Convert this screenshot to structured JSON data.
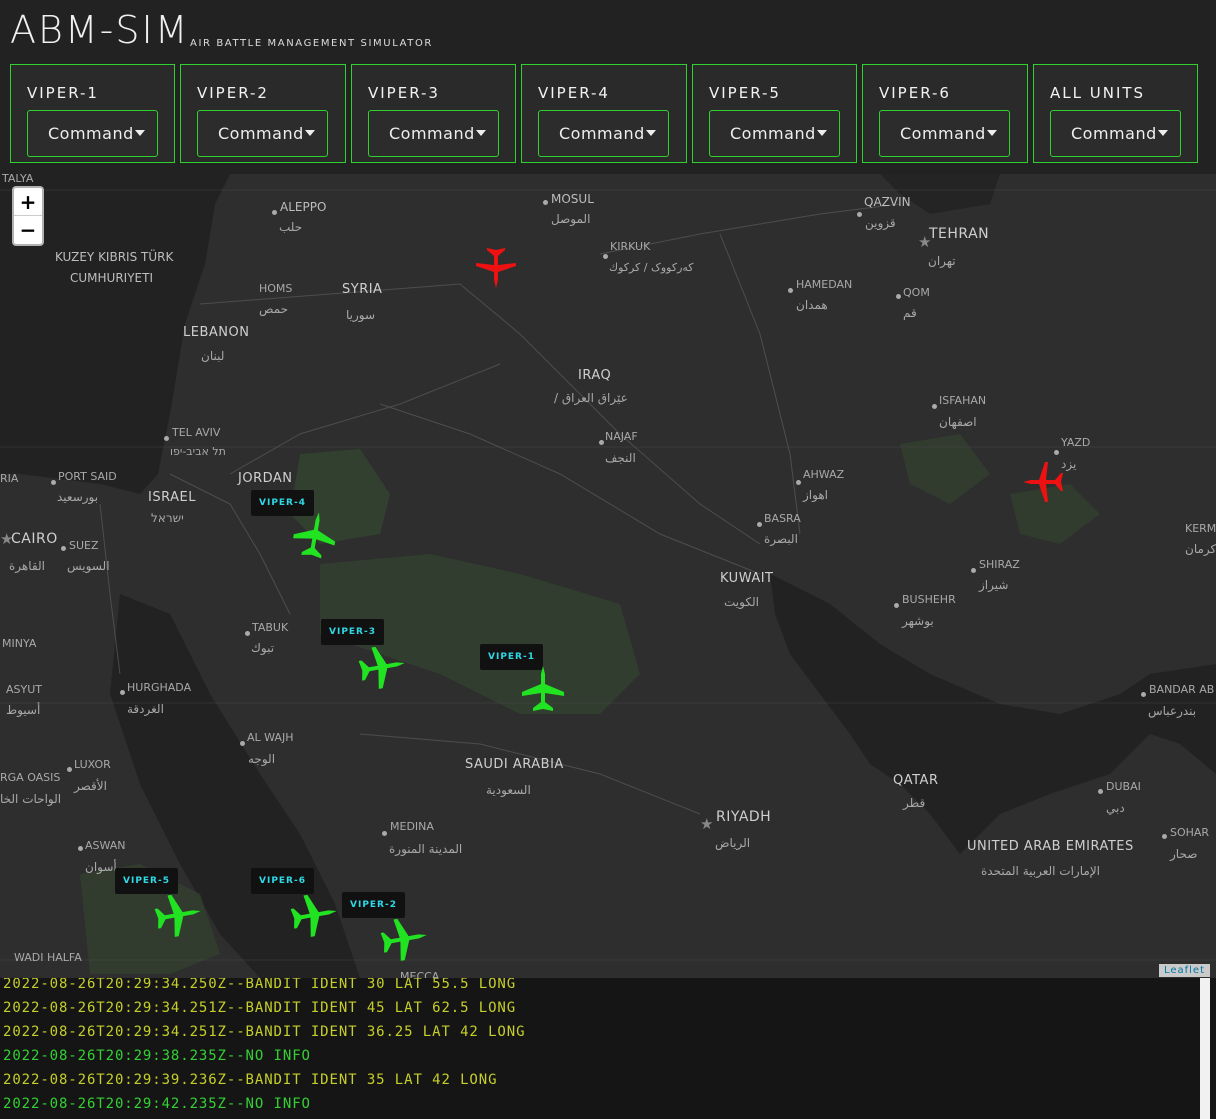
{
  "app": {
    "title": "ABM-SIM",
    "subtitle": "AIR BATTLE MANAGEMENT SIMULATOR"
  },
  "units": [
    {
      "name": "VIPER-1",
      "command_label": "Command"
    },
    {
      "name": "VIPER-2",
      "command_label": "Command"
    },
    {
      "name": "VIPER-3",
      "command_label": "Command"
    },
    {
      "name": "VIPER-4",
      "command_label": "Command"
    },
    {
      "name": "VIPER-5",
      "command_label": "Command"
    },
    {
      "name": "VIPER-6",
      "command_label": "Command"
    },
    {
      "name": "ALL UNITS",
      "command_label": "Command"
    }
  ],
  "map": {
    "zoom_in": "+",
    "zoom_out": "−",
    "attribution": "Leaflet",
    "labels": {
      "talya": "TALYA",
      "aleppo": "ALEPPO",
      "aleppo_ar": "حلب",
      "mosul": "MOSUL",
      "mosul_ar": "الموصل",
      "qazvin": "QAZVIN",
      "qazvin_ar": "قزوين",
      "tehran": "TEHRAN",
      "tehran_ar": "تهران",
      "kuzey1": "KUZEY KIBRIS TÜRK",
      "kuzey2": "CUMHURIYETI",
      "kirkuk": "KIRKUK",
      "kirkuk_ar": "كه‌ركووک / كركوك",
      "homs": "HOMS",
      "homs_ar": "حمص",
      "syria": "SYRIA",
      "syria_ar": "سوريا",
      "hamedan": "HAMEDAN",
      "hamedan_ar": "همدان",
      "qom": "QOM",
      "qom_ar": "قم",
      "lebanon": "LEBANON",
      "lebanon_ar": "لبنان",
      "iraq": "IRAQ",
      "iraq_ar": "/ عێراق العراق",
      "isfahan": "ISFAHAN",
      "isfahan_ar": "اصفهان",
      "telaviv": "TEL AVIV",
      "telaviv_ar": "תל אביב-יפו",
      "najaf": "NAJAF",
      "najaf_ar": "النجف",
      "yazd": "YAZD",
      "yazd_ar": "یزد",
      "ria": "RIA",
      "portsaid": "PORT SAID",
      "portsaid_ar": "بورسعيد",
      "israel": "ISRAEL",
      "israel_ar": "ישראל",
      "jordan": "JORDAN",
      "ahwaz": "AHWAZ",
      "ahwaz_ar": "اهواز",
      "basra": "BASRA",
      "basra_ar": "البصرة",
      "kerm": "KERM",
      "kerm_ar": "کرمان",
      "cairo": "CAIRO",
      "cairo_ar": "القاهرة",
      "suez": "SUEZ",
      "suez_ar": "السويس",
      "kuwait": "KUWAIT",
      "kuwait_ar": "الكويت",
      "shiraz": "SHIRAZ",
      "shiraz_ar": "شیراز",
      "bushehr": "BUSHEHR",
      "bushehr_ar": "بوشهر",
      "minya": "MINYA",
      "tabuk": "TABUK",
      "tabuk_ar": "تبوك",
      "asyut": "ASYUT",
      "asyut_ar": "أسيوط",
      "hurghada": "HURGHADA",
      "hurghada_ar": "الغردقة",
      "bandar": "BANDAR AB",
      "bandar_ar": "بندرعباس",
      "alwajh": "AL WAJH",
      "alwajh_ar": "الوجه",
      "luxor": "LUXOR",
      "luxor_ar": "الأقصر",
      "saudi": "SAUDI ARABIA",
      "saudi_ar": "السعودية",
      "qatar": "QATAR",
      "qatar_ar": "قطر",
      "dubai": "DUBAI",
      "dubai_ar": "دبي",
      "khargaoasis": "RGA OASIS",
      "khargaoasis_ar": "الواحات الخا",
      "riyadh": "RIYADH",
      "riyadh_ar": "الرياض",
      "medina": "MEDINA",
      "medina_ar": "المدينة المنورة",
      "sohar": "SOHAR",
      "sohar_ar": "صحار",
      "aswan": "ASWAN",
      "aswan_ar": "أسوان",
      "uae": "UNITED ARAB EMIRATES",
      "uae_ar": "الإمارات العربية المتحدة",
      "wadihalfa": "WADI HALFA",
      "mecca": "MECCA"
    },
    "friendly_tags": {
      "v1": "VIPER-1",
      "v2": "VIPER-2",
      "v3": "VIPER-3",
      "v4": "VIPER-4",
      "v5": "VIPER-5",
      "v6": "VIPER-6"
    },
    "colors": {
      "friendly": "#22e322",
      "hostile": "#ee1111",
      "tag_text": "#2fd9e6",
      "panel_border": "#2fd12f"
    }
  },
  "log": [
    {
      "type": "bandit",
      "text": "2022-08-26T20:29:34.250Z--BANDIT IDENT 30 LAT 55.5 LONG"
    },
    {
      "type": "bandit",
      "text": "2022-08-26T20:29:34.251Z--BANDIT IDENT 45 LAT 62.5 LONG"
    },
    {
      "type": "bandit",
      "text": "2022-08-26T20:29:34.251Z--BANDIT IDENT 36.25 LAT 42 LONG"
    },
    {
      "type": "info",
      "text": "2022-08-26T20:29:38.235Z--NO INFO"
    },
    {
      "type": "bandit",
      "text": "2022-08-26T20:29:39.236Z--BANDIT IDENT 35 LAT 42 LONG"
    },
    {
      "type": "info",
      "text": "2022-08-26T20:29:42.235Z--NO INFO"
    }
  ]
}
